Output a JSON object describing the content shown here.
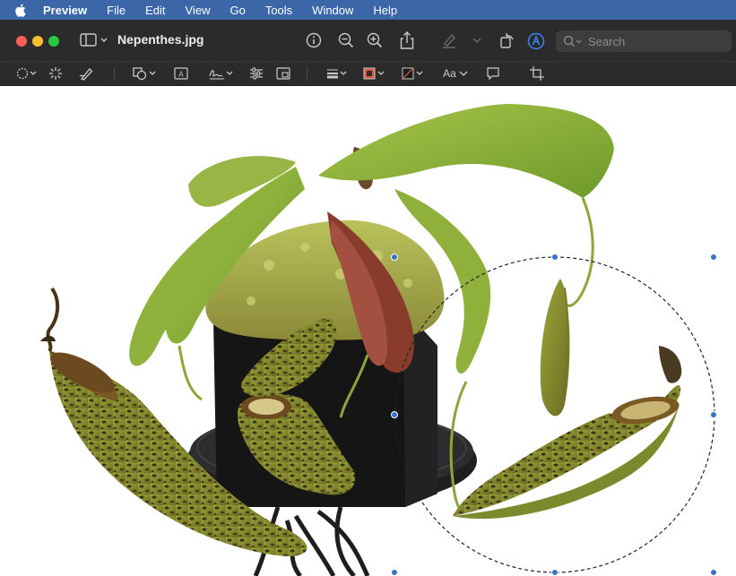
{
  "menubar": {
    "apple_icon": "apple-logo-icon",
    "items": [
      "Preview",
      "File",
      "Edit",
      "View",
      "Go",
      "Tools",
      "Window",
      "Help"
    ]
  },
  "window": {
    "title": "Nepenthes.jpg",
    "traffic_lights": {
      "close": "#ff5f57",
      "minimize": "#febc2e",
      "zoom": "#28c840"
    }
  },
  "toolbar": {
    "icons": [
      "sidebar-icon",
      "info-icon",
      "zoom-out-icon",
      "zoom-in-icon",
      "share-icon",
      "highlight-icon",
      "rotate-icon",
      "markup-icon"
    ],
    "search_placeholder": "Search"
  },
  "markup_toolbar": {
    "icons": [
      "selection-tool-icon",
      "instant-alpha-icon",
      "sketch-icon",
      "shapes-icon",
      "text-icon",
      "sign-icon",
      "adjust-color-icon",
      "adjust-size-icon",
      "shape-style-icon",
      "border-color-icon",
      "fill-color-icon",
      "text-style-icon",
      "annotate-icon",
      "crop-icon"
    ],
    "text_style_label": "Aa",
    "border_color": "#e0584a",
    "accent_color": "#3a72c7"
  },
  "document": {
    "image": "nepenthes-pitcher-plant-photo",
    "annotation": "dashed-ellipse-selection"
  }
}
